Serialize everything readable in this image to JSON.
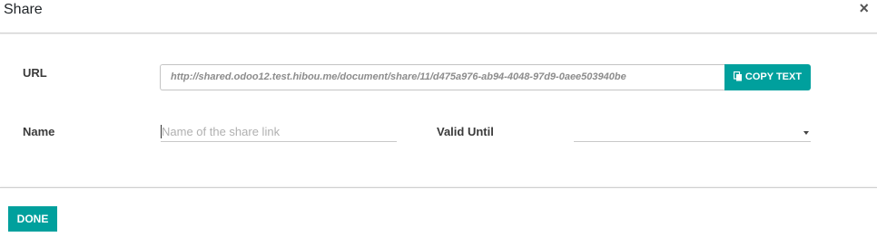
{
  "dialog": {
    "title": "Share",
    "close_glyph": "×"
  },
  "form": {
    "url_label": "URL",
    "url_value": "http://shared.odoo12.test.hibou.me/document/share/11/d475a976-ab94-4048-97d9-0aee503940be",
    "copy_label": "COPY TEXT",
    "copy_icon": "clipboard-icon",
    "name_label": "Name",
    "name_placeholder": "Name of the share link",
    "name_value": "",
    "valid_label": "Valid Until",
    "valid_value": ""
  },
  "footer": {
    "done_label": "DONE"
  },
  "colors": {
    "accent": "#00a09d",
    "text": "#3a3a3a",
    "placeholder": "#b0b0b0"
  }
}
